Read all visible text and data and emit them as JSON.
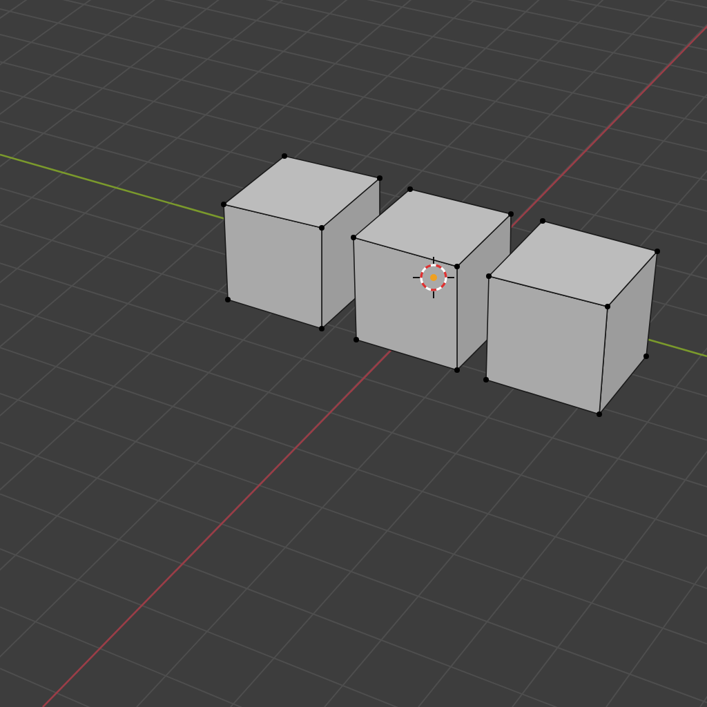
{
  "viewport": {
    "kind": "perspective",
    "show_grid": true,
    "show_axes": true
  },
  "objects": [
    {
      "kind": "cube"
    },
    {
      "kind": "cube"
    },
    {
      "kind": "cube"
    }
  ],
  "cursor": {
    "visible": true
  }
}
